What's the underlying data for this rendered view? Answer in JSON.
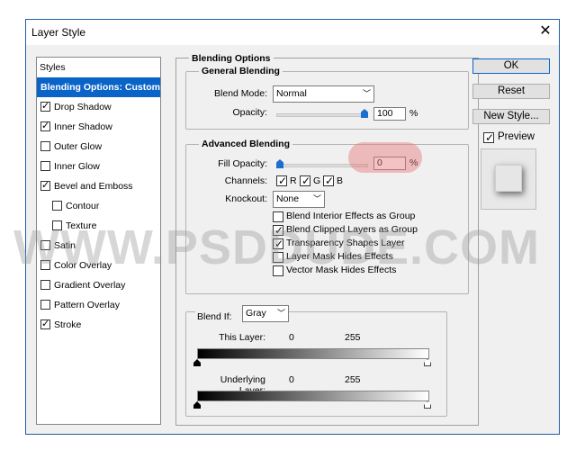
{
  "window": {
    "title": "Layer Style",
    "close_glyph": "✕"
  },
  "styles_list": {
    "header": "Styles",
    "items": [
      {
        "label": "Blending Options: Custom",
        "checkbox": false,
        "checked": false,
        "selected": true,
        "indent": false
      },
      {
        "label": "Drop Shadow",
        "checkbox": true,
        "checked": true,
        "indent": false
      },
      {
        "label": "Inner Shadow",
        "checkbox": true,
        "checked": true,
        "indent": false
      },
      {
        "label": "Outer Glow",
        "checkbox": true,
        "checked": false,
        "indent": false
      },
      {
        "label": "Inner Glow",
        "checkbox": true,
        "checked": false,
        "indent": false
      },
      {
        "label": "Bevel and Emboss",
        "checkbox": true,
        "checked": true,
        "indent": false
      },
      {
        "label": "Contour",
        "checkbox": true,
        "checked": false,
        "indent": true
      },
      {
        "label": "Texture",
        "checkbox": true,
        "checked": false,
        "indent": true
      },
      {
        "label": "Satin",
        "checkbox": true,
        "checked": false,
        "indent": false
      },
      {
        "label": "Color Overlay",
        "checkbox": true,
        "checked": false,
        "indent": false
      },
      {
        "label": "Gradient Overlay",
        "checkbox": true,
        "checked": false,
        "indent": false
      },
      {
        "label": "Pattern Overlay",
        "checkbox": true,
        "checked": false,
        "indent": false
      },
      {
        "label": "Stroke",
        "checkbox": true,
        "checked": true,
        "indent": false
      }
    ]
  },
  "blending_options": {
    "title": "Blending Options",
    "general": {
      "title": "General Blending",
      "blend_mode_label": "Blend Mode:",
      "blend_mode_value": "Normal",
      "opacity_label": "Opacity:",
      "opacity_value": "100",
      "opacity_unit": "%",
      "opacity_level": 1.0
    },
    "advanced": {
      "title": "Advanced Blending",
      "fill_opacity_label": "Fill Opacity:",
      "fill_opacity_value": "0",
      "fill_opacity_unit": "%",
      "fill_opacity_level": 0.0,
      "channels_label": "Channels:",
      "channels": [
        {
          "label": "R",
          "checked": true
        },
        {
          "label": "G",
          "checked": true
        },
        {
          "label": "B",
          "checked": true
        }
      ],
      "knockout_label": "Knockout:",
      "knockout_value": "None",
      "options": [
        {
          "label": "Blend Interior Effects as Group",
          "checked": false
        },
        {
          "label": "Blend Clipped Layers as Group",
          "checked": true
        },
        {
          "label": "Transparency Shapes Layer",
          "checked": true
        },
        {
          "label": "Layer Mask Hides Effects",
          "checked": false
        },
        {
          "label": "Vector Mask Hides Effects",
          "checked": false
        }
      ]
    },
    "blend_if": {
      "label": "Blend If:",
      "value": "Gray",
      "this_layer_label": "This Layer:",
      "this_layer_min": "0",
      "this_layer_max": "255",
      "underlying_label": "Underlying Layer:",
      "underlying_min": "0",
      "underlying_max": "255"
    }
  },
  "buttons": {
    "ok": "OK",
    "reset": "Reset",
    "new_style": "New Style...",
    "preview_label": "Preview",
    "preview_checked": true
  },
  "watermark": "WWW.PSDDUDE.COM",
  "colors": {
    "accent": "#0a64c8",
    "highlight": "#e67878"
  }
}
